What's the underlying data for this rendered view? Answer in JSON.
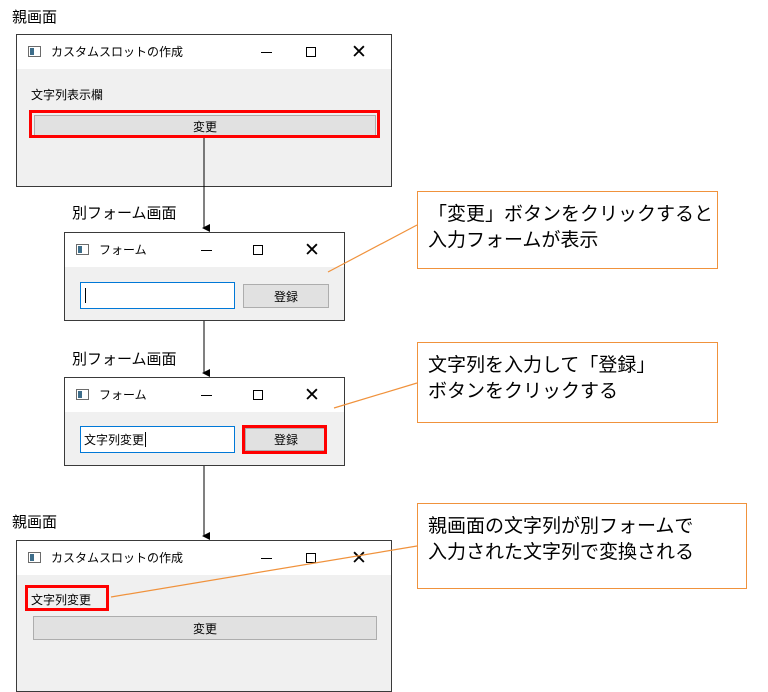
{
  "captions": {
    "parent_before": "親画面",
    "form_empty": "別フォーム画面",
    "form_filled": "別フォーム画面",
    "parent_after": "親画面"
  },
  "main_window": {
    "title": "カスタムスロットの作成",
    "label_initial": "文字列表示欄",
    "label_changed": "文字列変更",
    "change_button": "変更"
  },
  "form_window": {
    "title": "フォーム",
    "input_value_empty": "",
    "input_value_filled": "文字列変更",
    "register_button": "登録"
  },
  "callouts": {
    "step1": [
      "「変更」ボタンをクリックすると",
      "入力フォームが表示"
    ],
    "step2": [
      "文字列を入力して「登録」",
      "ボタンをクリックする"
    ],
    "step3": [
      "親画面の文字列が別フォームで",
      "入力された文字列で変換される"
    ]
  },
  "colors": {
    "highlight": "#ff0000",
    "callout_border": "#f0923c",
    "input_focus": "#0078d7",
    "window_body": "#f0f0f0"
  },
  "icons": {
    "window_controls": [
      "minimize-icon",
      "maximize-icon",
      "close-icon"
    ],
    "app": "app-window-icon"
  }
}
